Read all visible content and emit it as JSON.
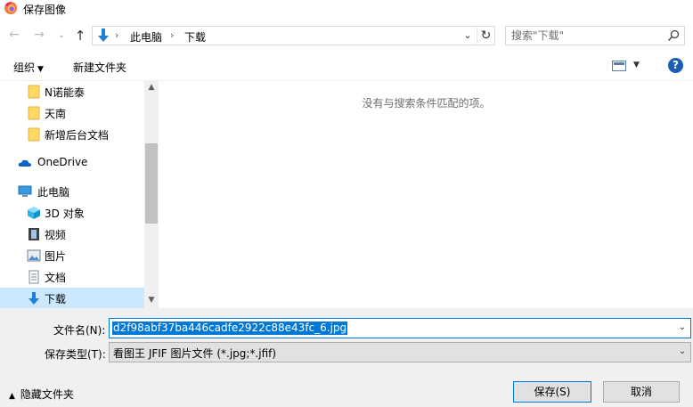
{
  "window": {
    "title": "保存图像"
  },
  "address": {
    "crumbs": [
      "此电脑",
      "下载"
    ],
    "search_placeholder": "搜索\"下载\""
  },
  "toolbar": {
    "organize_label": "组织",
    "new_folder_label": "新建文件夹",
    "help_label": "?"
  },
  "nav": {
    "items": [
      {
        "label": "N诺能泰",
        "icon": "folder-icon"
      },
      {
        "label": "天南",
        "icon": "folder-icon"
      },
      {
        "label": "新增后台文档",
        "icon": "folder-icon"
      },
      {
        "label": "OneDrive",
        "icon": "cloud-icon"
      },
      {
        "label": "此电脑",
        "icon": "computer-icon"
      },
      {
        "label": "3D 对象",
        "icon": "cube-3d-icon"
      },
      {
        "label": "视频",
        "icon": "video-icon"
      },
      {
        "label": "图片",
        "icon": "pictures-icon"
      },
      {
        "label": "文档",
        "icon": "documents-icon"
      },
      {
        "label": "下载",
        "icon": "download-icon",
        "selected": true
      }
    ]
  },
  "content": {
    "empty_message": "没有与搜索条件匹配的项。"
  },
  "form": {
    "filename_label": "文件名(N):",
    "filename_value": "d2f98abf37ba446cadfe2922c88e43fc_6.jpg",
    "savetype_label": "保存类型(T):",
    "savetype_value": "看图王 JFIF 图片文件 (*.jpg;*.jfif)",
    "hide_folders_label": "隐藏文件夹",
    "save_label": "保存(S)",
    "cancel_label": "取消"
  },
  "colors": {
    "accent": "#0078d7",
    "selection_bg": "#cce8ff",
    "folder": "#ffd866",
    "download_arrow": "#1e7fd6"
  }
}
